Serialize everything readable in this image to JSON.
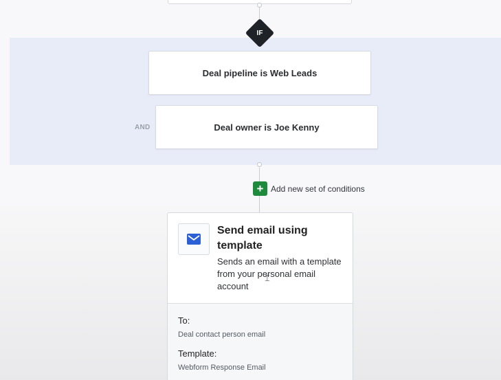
{
  "flow": {
    "if_label": "IF",
    "conditions": [
      {
        "text": "Deal pipeline is Web Leads"
      },
      {
        "connector": "AND",
        "text": "Deal owner is Joe Kenny"
      }
    ],
    "add_conditions_label": "Add new set of conditions",
    "add_icon": "+"
  },
  "action": {
    "icon": "envelope-icon",
    "title": "Send email using template",
    "description": "Sends an email with a template from your personal email account",
    "fields": [
      {
        "label": "To:",
        "value": "Deal contact person email"
      },
      {
        "label": "Template:",
        "value": "Webform Response Email"
      }
    ]
  },
  "colors": {
    "condition_band": "#e8ecf8",
    "if_diamond": "#1f2227",
    "add_button": "#1e8a3c",
    "mail_icon": "#2c5fd6"
  }
}
